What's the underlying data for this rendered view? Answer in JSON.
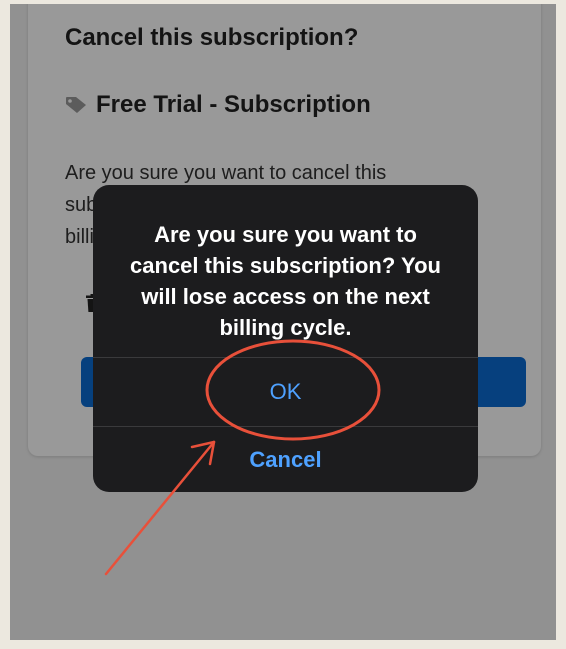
{
  "background_page": {
    "title": "Cancel this subscription?",
    "plan_name": "Free Trial - Subscription",
    "body_text": "Are you sure you want to cancel this subscription? You will lose access on the next billing cycle.",
    "icons": [
      "tag-icon",
      "trash-icon"
    ],
    "accent_color": "#0b6bd3"
  },
  "alert": {
    "message": "Are you sure you want to cancel this subscription? You will lose access on the next billing cycle.",
    "ok_label": "OK",
    "cancel_label": "Cancel",
    "background_color": "#1c1c1e",
    "button_color": "#4ea1ff"
  },
  "annotation": {
    "highlight_color": "#e8503a",
    "shapes": [
      "circle-highlight",
      "arrow"
    ]
  }
}
